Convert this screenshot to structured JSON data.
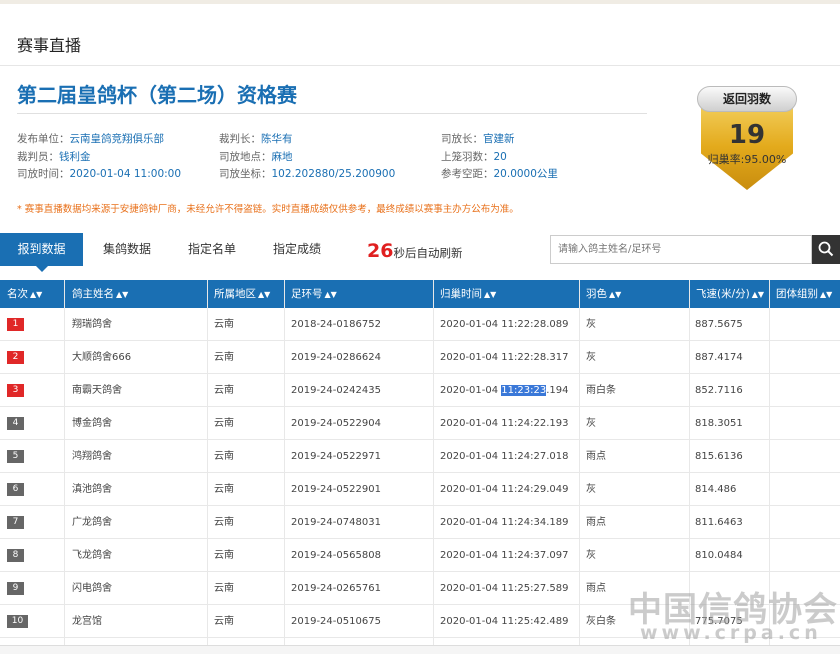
{
  "header": {
    "title": "赛事直播"
  },
  "race": {
    "title": "第二届皇鸽杯（第二场）资格赛"
  },
  "info": {
    "publisher_label": "发布单位：",
    "publisher": "云南皇鸽竞翔俱乐部",
    "referee_chief_label": "裁判长：",
    "referee_chief": "陈华有",
    "release_chief_label": "司放长：",
    "release_chief": "官建新",
    "referee_label": "裁判员：",
    "referee": "钱利金",
    "release_place_label": "司放地点：",
    "release_place": "麻地",
    "count_label": "上笼羽数：",
    "count": "20",
    "release_time_label": "司放时间：",
    "release_time": "2020-01-04 11:00:00",
    "coords_label": "司放坐标：",
    "coords": "102.202880/25.200900",
    "distance_label": "参考空距：",
    "distance": "20.0000公里"
  },
  "notice": "* 赛事直播数据均来源于安捷鸽钟厂商，未经允许不得盗链。实时直播成绩仅供参考，最终成绩以赛事主办方公布为准。",
  "badge": {
    "label": "返回羽数",
    "count": "19",
    "rate": "归巢率:95.00%",
    "color": "#e3aa1c"
  },
  "tabs": {
    "arrival": "报到数据",
    "collection": "集鸽数据",
    "designated_list": "指定名单",
    "designated_result": "指定成绩"
  },
  "refresh": {
    "seconds": "26",
    "text": "秒后自动刷新"
  },
  "search": {
    "placeholder": "请输入鸽主姓名/足环号",
    "icon": "search-icon"
  },
  "table": {
    "headers": {
      "rank": "名次",
      "owner": "鸽主姓名",
      "region": "所属地区",
      "ring": "足环号",
      "time": "归巢时间",
      "color": "羽色",
      "speed": "飞速(米/分)",
      "group": "团体组别"
    },
    "rows": [
      {
        "rank": "1",
        "owner": "翔瑞鸽舍",
        "region": "云南",
        "ring": "2018-24-0186752",
        "time": "2020-01-04 11:22:28.089",
        "color": "灰",
        "speed": "887.5675"
      },
      {
        "rank": "2",
        "owner": "大顺鸽舍666",
        "region": "云南",
        "ring": "2019-24-0286624",
        "time": "2020-01-04 11:22:28.317",
        "color": "灰",
        "speed": "887.4174"
      },
      {
        "rank": "3",
        "owner": "南霸天鸽舍",
        "region": "云南",
        "ring": "2019-24-0242435",
        "time_a": "2020-01-04 ",
        "time_b": "11:23:23",
        "time_c": ".194",
        "color": "雨白条",
        "speed": "852.7116"
      },
      {
        "rank": "4",
        "owner": "博金鸽舍",
        "region": "云南",
        "ring": "2019-24-0522904",
        "time": "2020-01-04 11:24:22.193",
        "color": "灰",
        "speed": "818.3051"
      },
      {
        "rank": "5",
        "owner": "鸿翔鸽舍",
        "region": "云南",
        "ring": "2019-24-0522971",
        "time": "2020-01-04 11:24:27.018",
        "color": "雨点",
        "speed": "815.6136"
      },
      {
        "rank": "6",
        "owner": "滇池鸽舍",
        "region": "云南",
        "ring": "2019-24-0522901",
        "time": "2020-01-04 11:24:29.049",
        "color": "灰",
        "speed": "814.486"
      },
      {
        "rank": "7",
        "owner": "广龙鸽舍",
        "region": "云南",
        "ring": "2019-24-0748031",
        "time": "2020-01-04 11:24:34.189",
        "color": "雨点",
        "speed": "811.6463"
      },
      {
        "rank": "8",
        "owner": "飞龙鸽舍",
        "region": "云南",
        "ring": "2019-24-0565808",
        "time": "2020-01-04 11:24:37.097",
        "color": "灰",
        "speed": "810.0484"
      },
      {
        "rank": "9",
        "owner": "闪电鸽舍",
        "region": "云南",
        "ring": "2019-24-0265761",
        "time": "2020-01-04 11:25:27.589",
        "color": "雨点",
        "speed": ""
      },
      {
        "rank": "10",
        "owner": "龙宫馆",
        "region": "云南",
        "ring": "2019-24-0510675",
        "time": "2020-01-04 11:25:42.489",
        "color": "灰白条",
        "speed": "775.7075"
      }
    ]
  },
  "watermark": {
    "line1": "中国信鸽协会",
    "line2": "www.crpa.cn"
  },
  "colors": {
    "primary": "#1a6fb3",
    "rank_top": "#e02828",
    "rank_other": "#666666",
    "refresh_num": "#e02020"
  }
}
